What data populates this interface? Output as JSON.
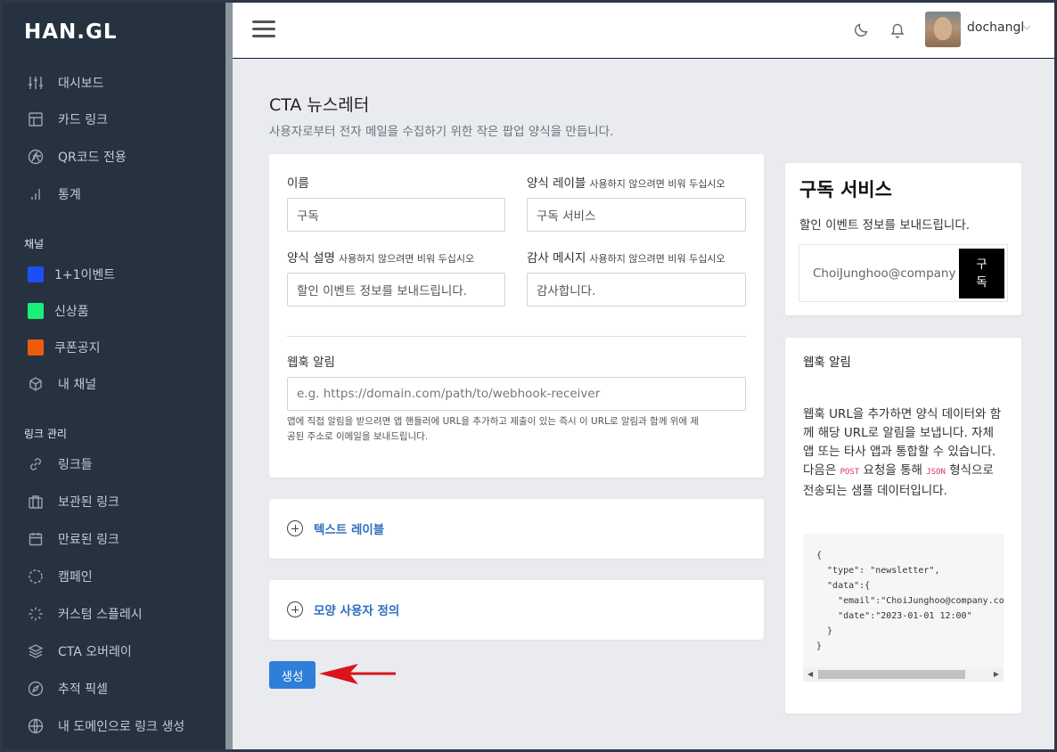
{
  "brand": {
    "logo": "HAN.GL"
  },
  "sidebar": {
    "main_items": [
      {
        "label": "대시보드",
        "icon": "sliders-icon"
      },
      {
        "label": "카드 링크",
        "icon": "layout-icon"
      },
      {
        "label": "QR코드 전용",
        "icon": "aperture-icon"
      },
      {
        "label": "통계",
        "icon": "bar-chart-icon"
      }
    ],
    "channels_title": "채널",
    "channels": [
      {
        "label": "1+1이벤트",
        "color": "#1e4ff5"
      },
      {
        "label": "신상품",
        "color": "#18f07a"
      },
      {
        "label": "쿠폰공지",
        "color": "#ef5b0c"
      },
      {
        "label": "내 채널",
        "icon": "box-icon"
      }
    ],
    "links_title": "링크 관리",
    "link_items": [
      {
        "label": "링크들",
        "icon": "link-icon"
      },
      {
        "label": "보관된 링크",
        "icon": "briefcase-icon"
      },
      {
        "label": "만료된 링크",
        "icon": "calendar-icon"
      },
      {
        "label": "캠페인",
        "icon": "circle-dashed-icon"
      },
      {
        "label": "커스텀 스플레시",
        "icon": "loader-icon"
      },
      {
        "label": "CTA 오버레이",
        "icon": "layers-icon"
      },
      {
        "label": "추적 픽셀",
        "icon": "compass-icon"
      },
      {
        "label": "내 도메인으로 링크 생성",
        "icon": "globe-icon"
      }
    ]
  },
  "header": {
    "username": "dochangl"
  },
  "page": {
    "title": "CTA 뉴스레터",
    "subtitle": "사용자로부터 전자 메일을 수집하기 위한 작은 팝업 양식을 만듭니다."
  },
  "form": {
    "name_label": "이름",
    "name_value": "구독",
    "form_label_label": "양식 레이블",
    "form_label_hint": "사용하지 않으려면 비워 두십시오",
    "form_label_value": "구독 서비스",
    "desc_label": "양식 설명",
    "desc_hint": "사용하지 않으려면 비워 두십시오",
    "desc_value": "할인 이벤트 정보를 보내드립니다.",
    "thanks_label": "감사 메시지",
    "thanks_hint": "사용하지 않으려면 비워 두십시오",
    "thanks_value": "감사합니다.",
    "webhook_label": "웹훅 알림",
    "webhook_placeholder": "e.g. https://domain.com/path/to/webhook-receiver",
    "webhook_help_1": "앱에 직접 알림을 받으려면 앱 핸들러에 URL을 추가하고 제출이 있는 즉시 이 URL로 알림과 함께 위에 제",
    "webhook_help_2": "공된 주소로 이메일을 보내드립니다."
  },
  "accordions": {
    "text_label": "텍스트 레이블",
    "appearance": "모양 사용자 정의"
  },
  "create_button": "생성",
  "preview": {
    "title": "구독 서비스",
    "desc": "할인 이벤트 정보를 보내드립니다.",
    "email": "ChoiJunghoo@company.com",
    "button": "구\n독"
  },
  "webhook_info": {
    "title": "웹훅 알림",
    "body_1": "웹훅 URL을 추가하면 양식 데이터와 함께 해당 URL로 알림을 보냅니다. 자체 앱 또는 타사 앱과 통합할 수 있습니다. 다음은 ",
    "post": "POST",
    "body_2": " 요청을 통해 ",
    "json": "JSON",
    "body_3": " 형식으로 전송되는 샘플 데이터입니다.",
    "code": "{\n  \"type\": \"newsletter\",\n  \"data\":{\n    \"email\":\"ChoiJunghoo@company.com\",\n    \"date\":\"2023-01-01 12:00\"\n  }\n}"
  }
}
